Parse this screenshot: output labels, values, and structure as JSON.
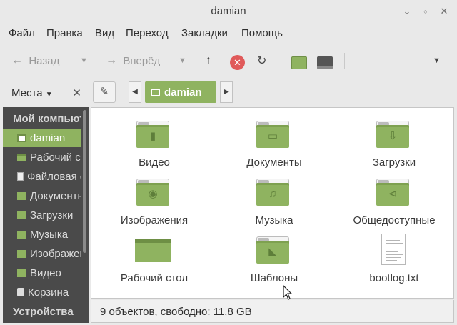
{
  "window": {
    "title": "damian"
  },
  "menu": [
    "Файл",
    "Правка",
    "Вид",
    "Переход",
    "Закладки",
    "Помощь"
  ],
  "toolbar": {
    "back_label": "Назад",
    "forward_label": "Вперёд"
  },
  "sidebar": {
    "header_label": "Места",
    "sections": [
      {
        "label": "Мой компьютер",
        "items": [
          {
            "label": "damian",
            "icon": "home-folder-icon",
            "active": true
          },
          {
            "label": "Рабочий стол",
            "icon": "desktop-icon"
          },
          {
            "label": "Файловая система",
            "icon": "filesystem-icon"
          },
          {
            "label": "Документы",
            "icon": "documents-folder-icon"
          },
          {
            "label": "Загрузки",
            "icon": "downloads-folder-icon"
          },
          {
            "label": "Музыка",
            "icon": "music-folder-icon"
          },
          {
            "label": "Изображения",
            "icon": "pictures-folder-icon"
          },
          {
            "label": "Видео",
            "icon": "videos-folder-icon"
          },
          {
            "label": "Корзина",
            "icon": "trash-icon"
          }
        ]
      },
      {
        "label": "Устройства",
        "items": []
      }
    ]
  },
  "pathbar": {
    "current": "damian"
  },
  "files": [
    {
      "name": "Видео",
      "icon": "videos-folder-icon"
    },
    {
      "name": "Документы",
      "icon": "documents-folder-icon"
    },
    {
      "name": "Загрузки",
      "icon": "downloads-folder-icon"
    },
    {
      "name": "Изображения",
      "icon": "pictures-folder-icon"
    },
    {
      "name": "Музыка",
      "icon": "music-folder-icon"
    },
    {
      "name": "Общедоступные",
      "icon": "public-folder-icon"
    },
    {
      "name": "Рабочий стол",
      "icon": "desktop-folder-icon"
    },
    {
      "name": "Шаблоны",
      "icon": "templates-folder-icon"
    },
    {
      "name": "bootlog.txt",
      "icon": "text-file-icon"
    }
  ],
  "status": {
    "text": "9 объектов, свободно: 11,8 GB"
  },
  "colors": {
    "accent": "#8fb360",
    "sidebar_bg": "#4a4a4a",
    "close_red": "#e05a5a"
  }
}
